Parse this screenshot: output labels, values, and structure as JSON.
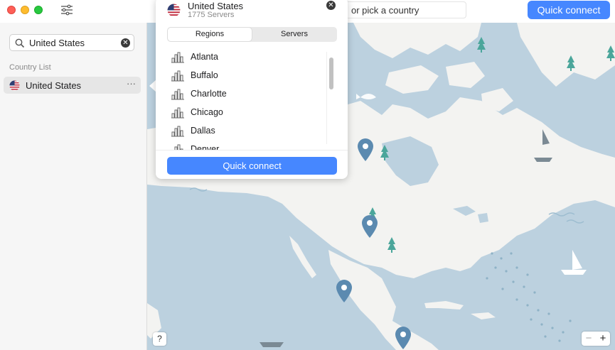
{
  "titlebar": {
    "search_text": "or pick a country",
    "quick_connect": "Quick connect"
  },
  "sidebar": {
    "search_value": "United States",
    "list_label": "Country List",
    "items": [
      {
        "label": "United States",
        "flag": "us-flag-icon"
      }
    ],
    "more": "···"
  },
  "popover": {
    "title": "United States",
    "subtitle": "1775 Servers",
    "tabs": [
      {
        "label": "Regions",
        "selected": true
      },
      {
        "label": "Servers",
        "selected": false
      }
    ],
    "cities": [
      "Atlanta",
      "Buffalo",
      "Charlotte",
      "Chicago",
      "Dallas",
      "Denver"
    ],
    "quick_connect": "Quick connect"
  },
  "map": {
    "help": "?",
    "zoom_out": "−",
    "zoom_in": "+"
  },
  "colors": {
    "accent": "#4687ff",
    "water": "#bcd1df",
    "land": "#f3f3f1",
    "pin": "#5b8ab0",
    "tree": "#4ba69b"
  }
}
